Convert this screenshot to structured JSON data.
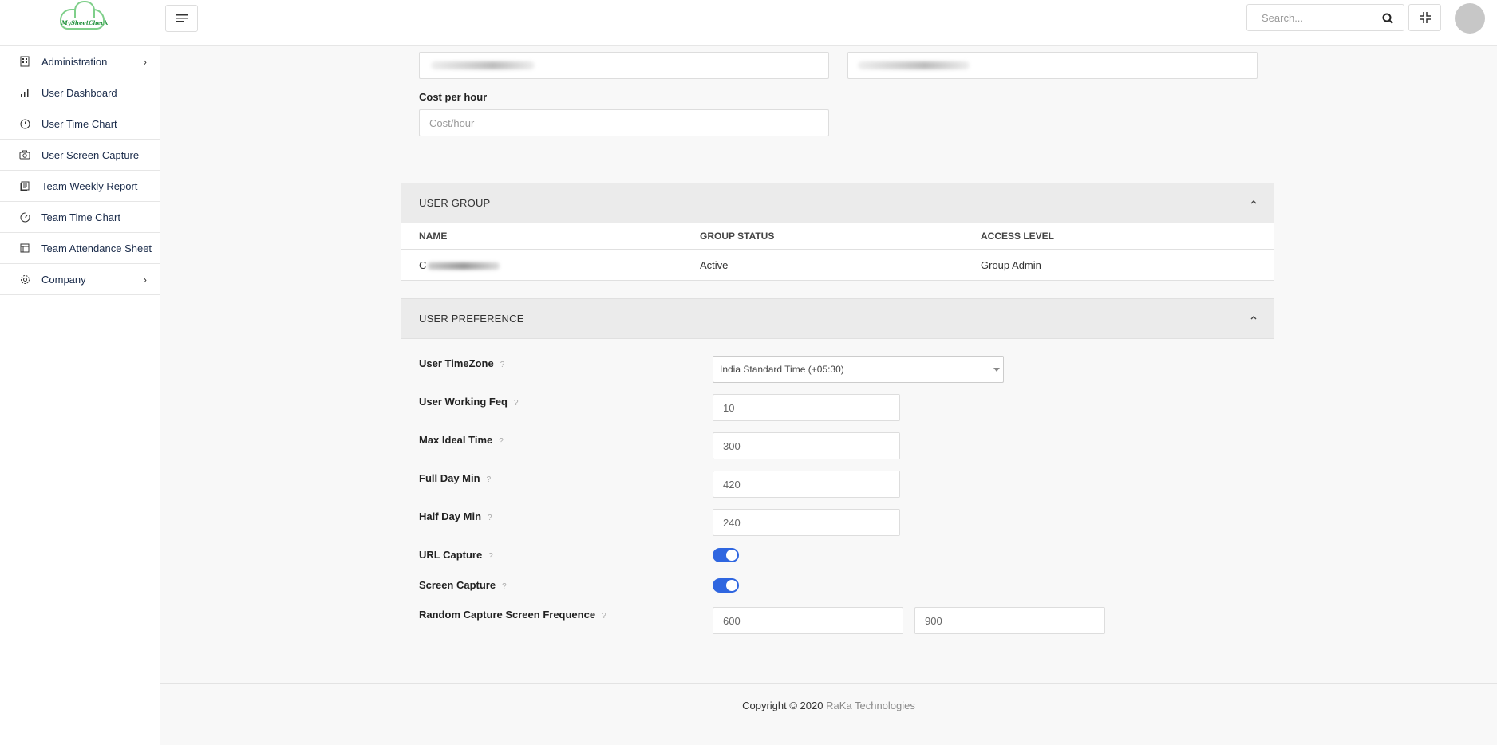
{
  "header": {
    "logo_text": "MySheetCheck",
    "search_placeholder": "Search..."
  },
  "sidebar": {
    "items": [
      {
        "label": "Administration",
        "icon": "building-icon",
        "has_children": true
      },
      {
        "label": "User Dashboard",
        "icon": "bar-chart-icon",
        "has_children": false
      },
      {
        "label": "User Time Chart",
        "icon": "clock-icon",
        "has_children": false
      },
      {
        "label": "User Screen Capture",
        "icon": "camera-icon",
        "has_children": false
      },
      {
        "label": "Team Weekly Report",
        "icon": "report-icon",
        "has_children": false
      },
      {
        "label": "Team Time Chart",
        "icon": "gauge-icon",
        "has_children": false
      },
      {
        "label": "Team Attendance Sheet",
        "icon": "table-icon",
        "has_children": false
      },
      {
        "label": "Company",
        "icon": "gear-icon",
        "has_children": true
      }
    ]
  },
  "user_details": {
    "cost_label": "Cost per hour",
    "cost_placeholder": "Cost/hour"
  },
  "user_group": {
    "title": "USER GROUP",
    "columns": [
      "NAME",
      "GROUP STATUS",
      "ACCESS LEVEL"
    ],
    "rows": [
      {
        "name": "C",
        "status": "Active",
        "access": "Group Admin"
      }
    ]
  },
  "user_preference": {
    "title": "USER PREFERENCE",
    "help_glyph": "?",
    "timezone_label": "User TimeZone",
    "timezone_value": "India Standard Time (+05:30)",
    "working_freq_label": "User Working Feq",
    "working_freq_value": "10",
    "max_ideal_label": "Max Ideal Time",
    "max_ideal_value": "300",
    "full_day_label": "Full Day Min",
    "full_day_value": "420",
    "half_day_label": "Half Day Min",
    "half_day_value": "240",
    "url_capture_label": "URL Capture",
    "url_capture_on": true,
    "screen_capture_label": "Screen Capture",
    "screen_capture_on": true,
    "random_freq_label": "Random Capture Screen Frequence",
    "random_freq_min": "600",
    "random_freq_max": "900"
  },
  "footer": {
    "copyright": "Copyright © 2020",
    "company_link": "RaKa Technologies"
  },
  "colors": {
    "accent": "#2f66e0",
    "brand_green": "#1f8f3a"
  }
}
